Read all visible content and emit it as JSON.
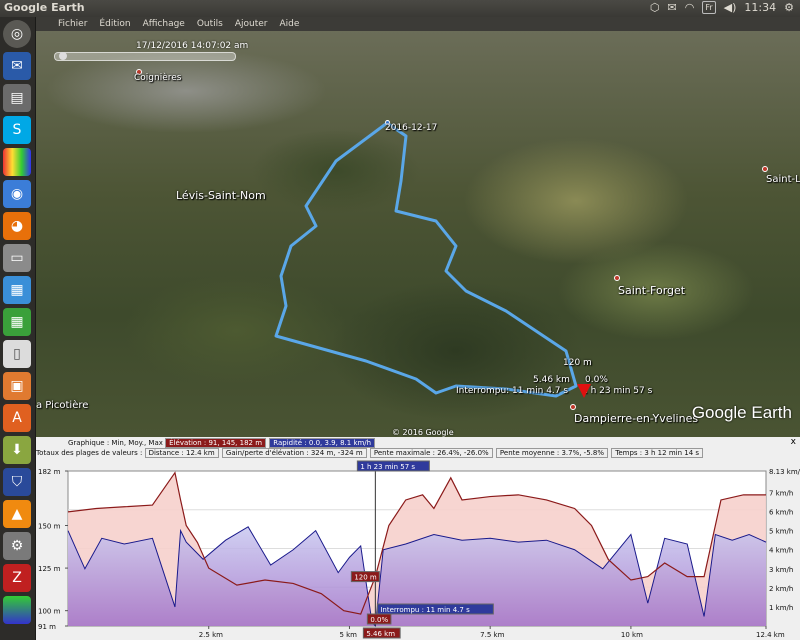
{
  "topbar": {
    "app_title": "Google Earth",
    "keyboard": "Fr",
    "clock": "11:34"
  },
  "menu": [
    "Fichier",
    "Édition",
    "Affichage",
    "Outils",
    "Ajouter",
    "Aide"
  ],
  "map": {
    "timeslider_date": "17/12/2016 14:07:02 am",
    "places": [
      {
        "name": "Coignières"
      },
      {
        "name": "Lévis-Saint-Nom"
      },
      {
        "name": "Saint-Forget"
      },
      {
        "name": "Dampierre-en-Yvelines"
      },
      {
        "name": "Saint-L"
      },
      {
        "name": "a Picotière"
      }
    ],
    "track_start_label": "2016-12-17",
    "cursor_elevation": "120 m",
    "cursor_distance": "5.46 km",
    "cursor_grade": "0.0%",
    "cursor_interrupted": "Interrompu: 11 min 4.7 s",
    "cursor_elapsed": "1 h 23 min 57 s",
    "copyright": "© 2016 Google",
    "logo": "Google Earth"
  },
  "profile": {
    "graph_label": "Graphique : Min, Moy., Max",
    "elevation_summary": "Élévation : 91, 145, 182 m",
    "speed_summary": "Rapidité : 0.0, 3.9, 8.1 km/h",
    "totals_label": "Totaux des plages de valeurs :",
    "distance": "Distance : 12.4 km",
    "elev_gain": "Gain/perte d'élévation : 324 m, -324 m",
    "max_grade": "Pente maximale : 26.4%, -26.0%",
    "avg_grade": "Pente moyenne : 3.7%, -5.8%",
    "time": "Temps : 3 h 12 min 14 s",
    "close": "x",
    "cursor_top": "1 h 23 min 57 s",
    "cursor_elev": "120 m",
    "cursor_grade": "0.0%",
    "cursor_dist": "5.46 km",
    "cursor_interrupted": "Interrompu : 11 min 4.7 s"
  },
  "chart_data": {
    "type": "area",
    "x_ticks": [
      "2.5 km",
      "5 km",
      "7.5 km",
      "10 km",
      "12.4 km"
    ],
    "left_ticks": [
      "182 m",
      "150 m",
      "125 m",
      "100 m",
      "91 m"
    ],
    "right_ticks": [
      "8.13 km/h",
      "7 km/h",
      "6 km/h",
      "5 km/h",
      "4 km/h",
      "3 km/h",
      "2 km/h",
      "1 km/h"
    ],
    "series": [
      {
        "name": "Élévation",
        "unit": "m",
        "color": "#8b1a1a",
        "x": [
          0,
          0.5,
          1.0,
          1.5,
          1.9,
          2.0,
          2.1,
          2.3,
          2.5,
          3.0,
          3.5,
          4.0,
          4.5,
          4.9,
          5.2,
          5.46,
          5.7,
          6.0,
          6.3,
          6.5,
          6.8,
          7.0,
          7.5,
          8.0,
          8.5,
          9.0,
          9.3,
          9.6,
          10.0,
          10.3,
          10.6,
          11.0,
          11.3,
          11.6,
          12.0,
          12.4
        ],
        "y": [
          158,
          160,
          161,
          162,
          181,
          165,
          150,
          140,
          125,
          115,
          118,
          116,
          110,
          100,
          98,
          120,
          150,
          165,
          168,
          160,
          178,
          165,
          167,
          168,
          165,
          160,
          150,
          130,
          118,
          120,
          128,
          120,
          120,
          165,
          168,
          168
        ]
      },
      {
        "name": "Rapidité",
        "unit": "km/h",
        "color": "#1a1a8b",
        "x": [
          0,
          0.3,
          0.6,
          1.0,
          1.5,
          1.9,
          2.0,
          2.1,
          2.4,
          2.8,
          3.2,
          3.6,
          4.0,
          4.4,
          4.8,
          5.0,
          5.2,
          5.4,
          5.46,
          5.6,
          6.0,
          6.5,
          7.0,
          7.5,
          8.0,
          8.5,
          9.0,
          9.5,
          10.0,
          10.3,
          10.6,
          11.0,
          11.3,
          11.5,
          11.8,
          12.1,
          12.4
        ],
        "y": [
          5.0,
          3.0,
          4.6,
          4.3,
          4.6,
          1.0,
          5.0,
          4.4,
          3.5,
          4.5,
          5.2,
          3.2,
          4.0,
          5.0,
          2.8,
          3.6,
          4.2,
          0.2,
          0.0,
          4.0,
          4.3,
          4.8,
          4.5,
          4.6,
          4.4,
          4.5,
          4.0,
          3.0,
          4.8,
          1.2,
          4.6,
          4.3,
          0.5,
          4.8,
          4.5,
          4.8,
          4.4
        ]
      }
    ],
    "xlim": [
      0,
      12.4
    ],
    "elev_lim": [
      91,
      182
    ],
    "speed_lim": [
      0,
      8.13
    ],
    "grid": true
  }
}
